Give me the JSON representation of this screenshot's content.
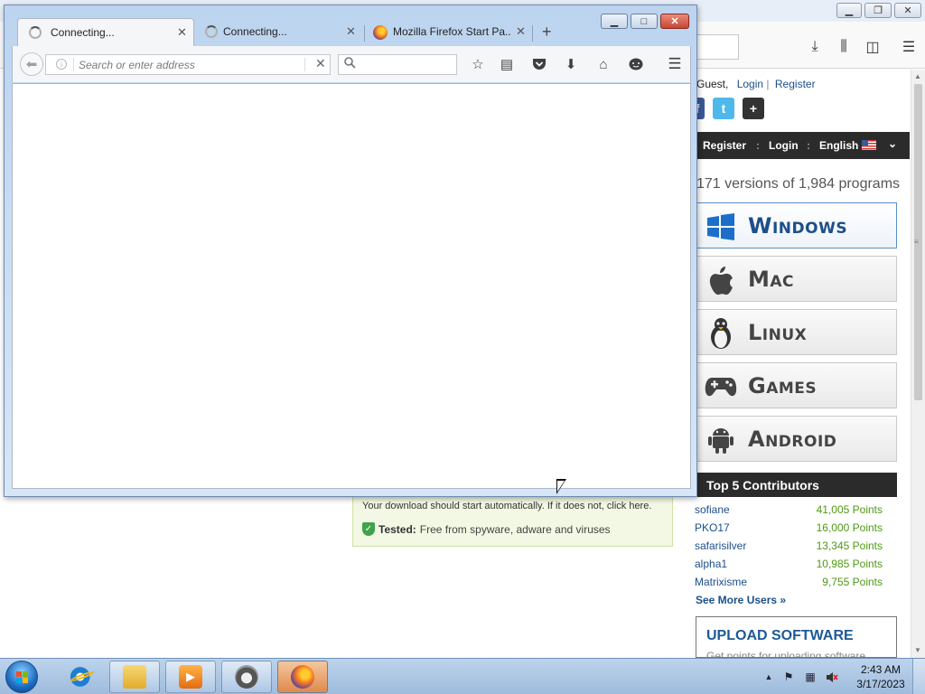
{
  "background_site": {
    "guest_prefix": "Guest,",
    "login_link": "Login",
    "register_link": "Register",
    "nav": {
      "register": "Register",
      "sep1": ":",
      "login": "Login",
      "sep2": ":",
      "language": "English"
    },
    "versions_text": "171 versions of 1,984 programs",
    "platforms": [
      {
        "label": "Windows",
        "icon": "windows-logo-icon"
      },
      {
        "label": "Mac",
        "icon": "apple-logo-icon"
      },
      {
        "label": "Linux",
        "icon": "tux-penguin-icon"
      },
      {
        "label": "Games",
        "icon": "gamepad-icon"
      },
      {
        "label": "Android",
        "icon": "android-robot-icon"
      }
    ],
    "contributors_title": "Top 5 Contributors",
    "contributors": [
      {
        "name": "sofiane",
        "points": "41,005 Points"
      },
      {
        "name": "PKO17",
        "points": "16,000 Points"
      },
      {
        "name": "safarisilver",
        "points": "13,345 Points"
      },
      {
        "name": "alpha1",
        "points": "10,985 Points"
      },
      {
        "name": "Matrixisme",
        "points": "9,755 Points"
      }
    ],
    "see_more": "See More Users »",
    "upload_title": "UPLOAD SOFTWARE",
    "upload_sub": "Get points for uploading software",
    "download_message": "Your download should start automatically. If it does not, click here.",
    "tested_label": "Tested:",
    "tested_text": "Free from spyware, adware and viruses"
  },
  "firefox": {
    "tabs": [
      {
        "label": "Connecting...",
        "selected": true,
        "icon": "loading-spinner-icon"
      },
      {
        "label": "Connecting...",
        "selected": false,
        "icon": "loading-spinner-icon"
      },
      {
        "label": "Mozilla Firefox Start Pa...",
        "selected": false,
        "icon": "firefox-logo-icon"
      }
    ],
    "new_tab": "+",
    "address_placeholder": "Search or enter address",
    "search_placeholder": ""
  },
  "taskbar": {
    "time": "2:43 AM",
    "date": "3/17/2023"
  },
  "colors": {
    "accent_blue": "#1c4f8a",
    "points_green": "#4f9a14",
    "dark_bar": "#2b2b2b"
  }
}
